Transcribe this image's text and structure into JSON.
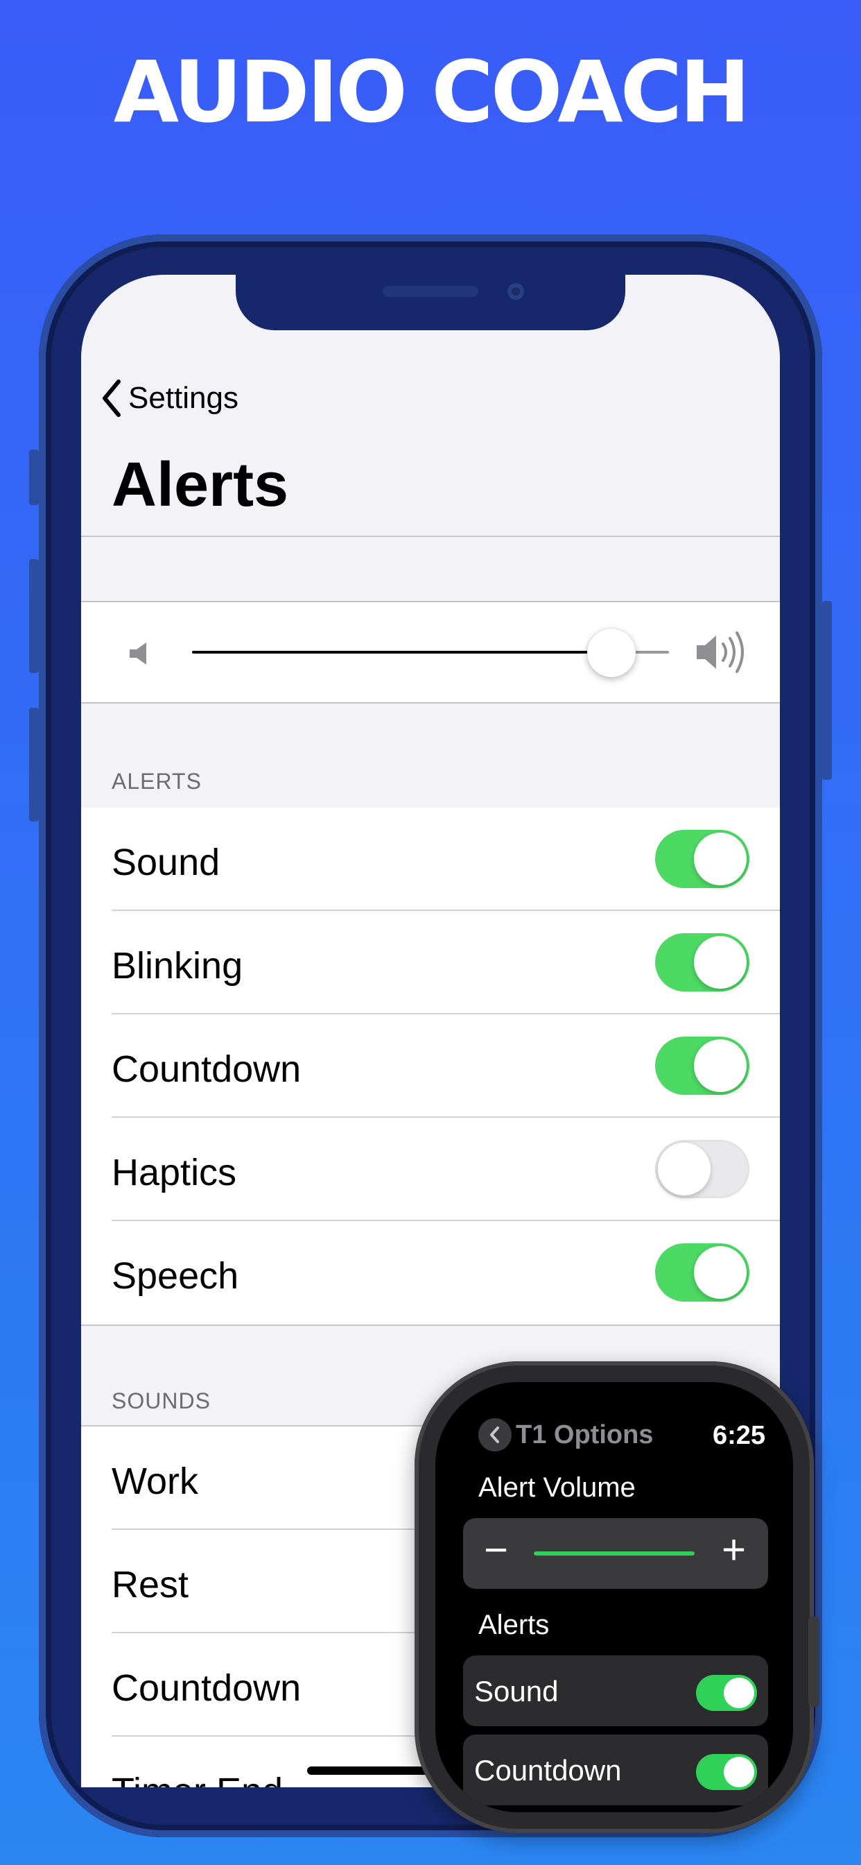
{
  "banner": {
    "title": "AUDIO COACH"
  },
  "colors": {
    "background": "#3a5cf8",
    "toggle_on": "#4cd964",
    "watch_accent": "#30d158"
  },
  "phone": {
    "nav": {
      "back_label": "Settings",
      "back_icon": "chevron-left-icon"
    },
    "title": "Alerts",
    "volume": {
      "level": 0.88,
      "low_icon": "speaker-low-icon",
      "high_icon": "speaker-high-icon"
    },
    "alerts": {
      "header": "ALERTS",
      "items": [
        {
          "label": "Sound",
          "on": true
        },
        {
          "label": "Blinking",
          "on": true
        },
        {
          "label": "Countdown",
          "on": true
        },
        {
          "label": "Haptics",
          "on": false
        },
        {
          "label": "Speech",
          "on": true
        }
      ]
    },
    "sounds": {
      "header": "SOUNDS",
      "items": [
        {
          "label": "Work"
        },
        {
          "label": "Rest"
        },
        {
          "label": "Countdown"
        },
        {
          "label": "Timer End"
        }
      ]
    }
  },
  "watch": {
    "back_label": "T1 Options",
    "time": "6:25",
    "volume_heading": "Alert Volume",
    "volume": {
      "minus": "−",
      "plus": "+",
      "level": 1.0
    },
    "alerts_heading": "Alerts",
    "alerts": [
      {
        "label": "Sound",
        "on": true
      },
      {
        "label": "Countdown",
        "on": true
      }
    ]
  }
}
